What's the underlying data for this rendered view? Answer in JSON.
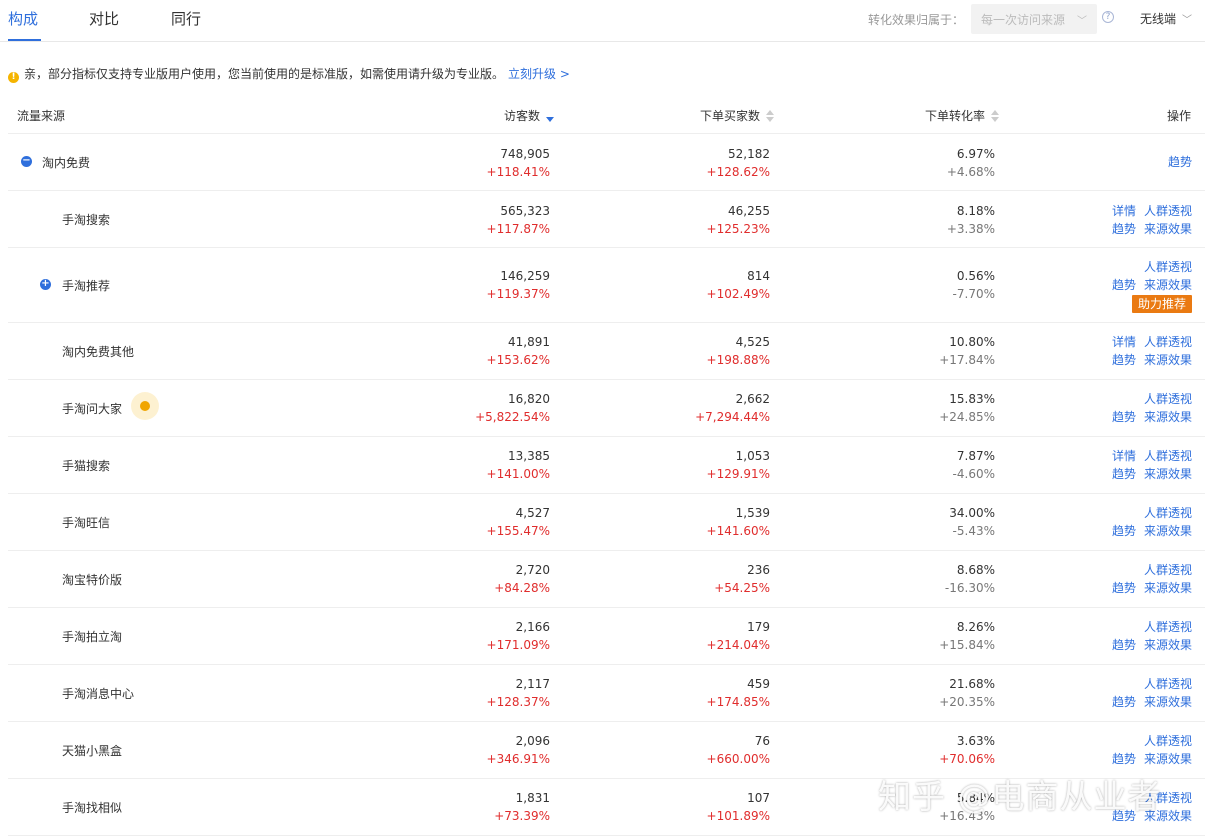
{
  "tabs": [
    {
      "label": "构成",
      "active": true
    },
    {
      "label": "对比",
      "active": false
    },
    {
      "label": "同行",
      "active": false
    }
  ],
  "attribution": {
    "label": "转化效果归属于：",
    "value": "每一次访问来源"
  },
  "device": {
    "value": "无线端"
  },
  "notice": {
    "text": "亲，部分指标仅支持专业版用户使用，您当前使用的是标准版，如需使用请升级为专业版。",
    "link": "立刻升级 >"
  },
  "table": {
    "headers": {
      "source": "流量来源",
      "visitors": "访客数",
      "buyers": "下单买家数",
      "rate": "下单转化率",
      "ops": "操作"
    },
    "rows": [
      {
        "name": "淘内免费",
        "visitors": "748,905",
        "visitors_chg": "+118.41%",
        "buyers": "52,182",
        "buyers_chg": "+128.62%",
        "rate": "6.97%",
        "rate_chg": "+4.68%"
      },
      {
        "name": "手淘搜索",
        "visitors": "565,323",
        "visitors_chg": "+117.87%",
        "buyers": "46,255",
        "buyers_chg": "+125.23%",
        "rate": "8.18%",
        "rate_chg": "+3.38%"
      },
      {
        "name": "手淘推荐",
        "visitors": "146,259",
        "visitors_chg": "+119.37%",
        "buyers": "814",
        "buyers_chg": "+102.49%",
        "rate": "0.56%",
        "rate_chg": "-7.70%"
      },
      {
        "name": "淘内免费其他",
        "visitors": "41,891",
        "visitors_chg": "+153.62%",
        "buyers": "4,525",
        "buyers_chg": "+198.88%",
        "rate": "10.80%",
        "rate_chg": "+17.84%"
      },
      {
        "name": "手淘问大家",
        "visitors": "16,820",
        "visitors_chg": "+5,822.54%",
        "buyers": "2,662",
        "buyers_chg": "+7,294.44%",
        "rate": "15.83%",
        "rate_chg": "+24.85%"
      },
      {
        "name": "手猫搜索",
        "visitors": "13,385",
        "visitors_chg": "+141.00%",
        "buyers": "1,053",
        "buyers_chg": "+129.91%",
        "rate": "7.87%",
        "rate_chg": "-4.60%"
      },
      {
        "name": "手淘旺信",
        "visitors": "4,527",
        "visitors_chg": "+155.47%",
        "buyers": "1,539",
        "buyers_chg": "+141.60%",
        "rate": "34.00%",
        "rate_chg": "-5.43%"
      },
      {
        "name": "淘宝特价版",
        "visitors": "2,720",
        "visitors_chg": "+84.28%",
        "buyers": "236",
        "buyers_chg": "+54.25%",
        "rate": "8.68%",
        "rate_chg": "-16.30%"
      },
      {
        "name": "手淘拍立淘",
        "visitors": "2,166",
        "visitors_chg": "+171.09%",
        "buyers": "179",
        "buyers_chg": "+214.04%",
        "rate": "8.26%",
        "rate_chg": "+15.84%"
      },
      {
        "name": "手淘消息中心",
        "visitors": "2,117",
        "visitors_chg": "+128.37%",
        "buyers": "459",
        "buyers_chg": "+174.85%",
        "rate": "21.68%",
        "rate_chg": "+20.35%"
      },
      {
        "name": "天猫小黑盒",
        "visitors": "2,096",
        "visitors_chg": "+346.91%",
        "buyers": "76",
        "buyers_chg": "+660.00%",
        "rate": "3.63%",
        "rate_chg": "+70.06%"
      },
      {
        "name": "手淘找相似",
        "visitors": "1,831",
        "visitors_chg": "+73.39%",
        "buyers": "107",
        "buyers_chg": "+101.89%",
        "rate": "5.84%",
        "rate_chg": "+16.43%"
      }
    ]
  },
  "ops": {
    "trend": "趋势",
    "detail": "详情",
    "crowd": "人群透视",
    "source_effect": "来源效果",
    "boost": "助力推荐"
  },
  "watermark": "知乎 @电商从业者",
  "colors": {
    "accent": "#2f6fdc",
    "positive": "#e02d2d",
    "boost": "#ea7a12"
  }
}
